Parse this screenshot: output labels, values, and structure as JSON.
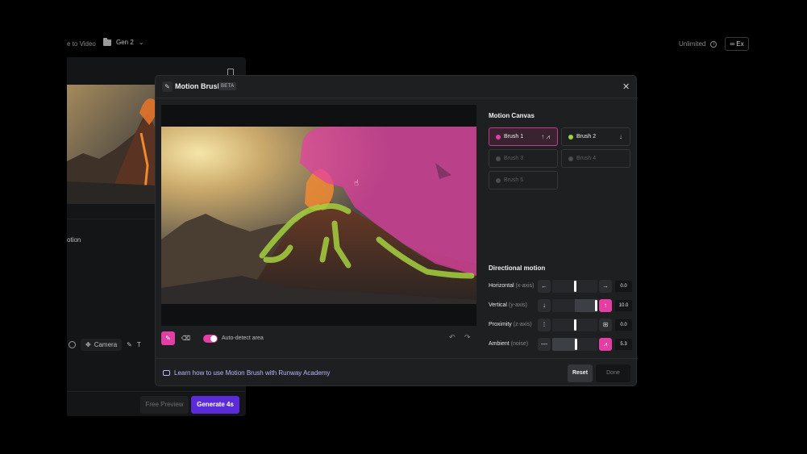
{
  "topbar": {
    "crumb_left": "e to Video",
    "crumb_gen": "Gen 2",
    "plan": "Unlimited",
    "export_label": "Ex"
  },
  "background_panel": {
    "motion_label": "otion",
    "camera_label": "Camera",
    "free_preview": "Free Preview",
    "generate": "Generate 4s"
  },
  "modal": {
    "title": "Motion Brush",
    "badge": "BETA",
    "auto_detect": "Auto-detect area",
    "learn_link": "Learn how to use Motion Brush with Runway Academy",
    "reset": "Reset",
    "done": "Done"
  },
  "motion_canvas": {
    "title": "Motion Canvas",
    "brushes": [
      {
        "label": "Brush 1",
        "color": "#e43ea4",
        "selected": true,
        "active": true,
        "icons": "↑ ⩘"
      },
      {
        "label": "Brush 2",
        "color": "#a4d040",
        "selected": false,
        "active": true,
        "icons": "↓"
      },
      {
        "label": "Brush 3",
        "color": "#4a4c50",
        "selected": false,
        "active": false,
        "icons": ""
      },
      {
        "label": "Brush 4",
        "color": "#4a4c50",
        "selected": false,
        "active": false,
        "icons": ""
      },
      {
        "label": "Brush 5",
        "color": "#4a4c50",
        "selected": false,
        "active": false,
        "icons": ""
      }
    ]
  },
  "directional_motion": {
    "title": "Directional motion",
    "rows": [
      {
        "label": "Horizontal",
        "axis": "(x-axis)",
        "left_icon": "←",
        "right_icon": "→",
        "value": "0.0",
        "level": 0.5,
        "fill_from": 0.5,
        "right_active": false
      },
      {
        "label": "Vertical",
        "axis": "(y-axis)",
        "left_icon": "↓",
        "right_icon": "↑",
        "value": "10.0",
        "level": 1.0,
        "fill_from": 0.5,
        "right_active": true
      },
      {
        "label": "Proximity",
        "axis": "(z-axis)",
        "left_icon": "⁞",
        "right_icon": "⊞",
        "value": "0.0",
        "level": 0.5,
        "fill_from": 0.5,
        "right_active": false
      },
      {
        "label": "Ambient",
        "axis": "(noise)",
        "left_icon": "—",
        "right_icon": "⩘",
        "value": "5.3",
        "level": 0.53,
        "fill_from": 0.0,
        "right_active": true
      }
    ]
  },
  "colors": {
    "accent_pink": "#e43ea4",
    "accent_green": "#a4d040",
    "generate_purple": "#5b2bd9"
  }
}
